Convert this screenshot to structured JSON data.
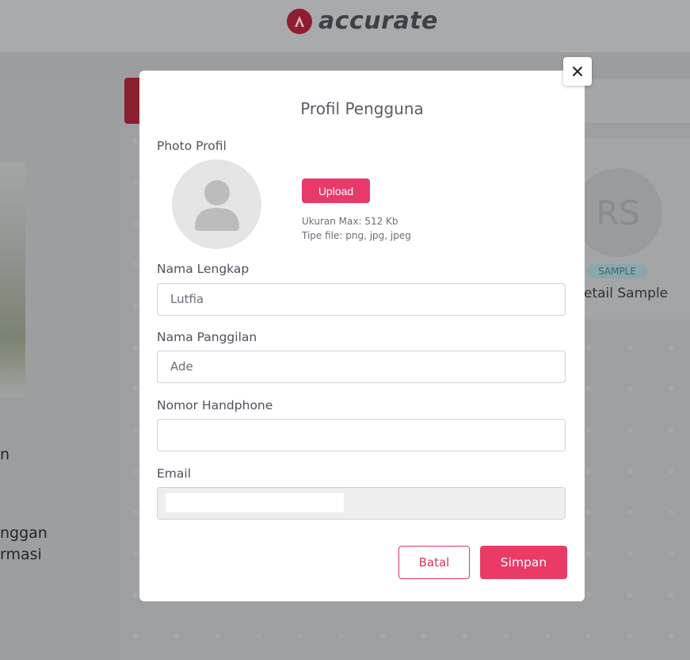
{
  "app": {
    "brand": "accurate"
  },
  "background": {
    "left_texts": [
      "n",
      "nggan",
      "rmasi"
    ],
    "card": {
      "initials": "RS",
      "badge": "SAMPLE",
      "title": "etail Sample"
    }
  },
  "modal": {
    "title": "Profil Pengguna",
    "photo": {
      "label": "Photo Profil",
      "upload_label": "Upload",
      "hint_size": "Ukuran Max: 512 Kb",
      "hint_type": "Tipe file: png, jpg, jpeg"
    },
    "full_name": {
      "label": "Nama Lengkap",
      "value": "Lutfia"
    },
    "nickname": {
      "label": "Nama Panggilan",
      "value": "Ade"
    },
    "phone": {
      "label": "Nomor Handphone",
      "value": ""
    },
    "email": {
      "label": "Email",
      "value": ""
    },
    "cancel_label": "Batal",
    "save_label": "Simpan"
  },
  "colors": {
    "accent": "#ea3a66",
    "brand": "#8e1d2f"
  }
}
